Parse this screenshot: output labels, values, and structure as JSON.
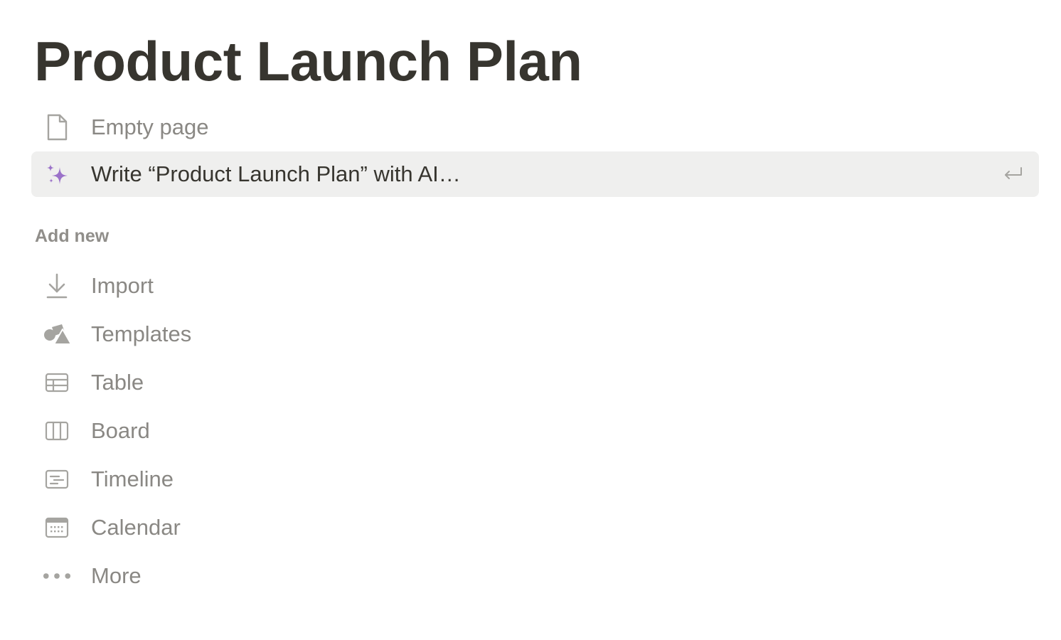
{
  "page": {
    "title": "Product Launch Plan"
  },
  "top_options": [
    {
      "label": "Empty page",
      "icon": "page-icon"
    },
    {
      "label": "Write “Product Launch Plan” with AI…",
      "icon": "ai-sparkle-icon",
      "accent": "#9b72c9"
    }
  ],
  "add_new": {
    "header": "Add new",
    "items": [
      {
        "label": "Import",
        "icon": "import-icon"
      },
      {
        "label": "Templates",
        "icon": "templates-icon"
      },
      {
        "label": "Table",
        "icon": "table-icon"
      },
      {
        "label": "Board",
        "icon": "board-icon"
      },
      {
        "label": "Timeline",
        "icon": "timeline-icon"
      },
      {
        "label": "Calendar",
        "icon": "calendar-icon"
      },
      {
        "label": "More",
        "icon": "more-icon"
      }
    ]
  },
  "colors": {
    "title": "#37352f",
    "muted_text": "#8a8884",
    "icon": "#a5a4a0",
    "highlight_bg": "#efefee",
    "ai_accent": "#9b72c9"
  }
}
